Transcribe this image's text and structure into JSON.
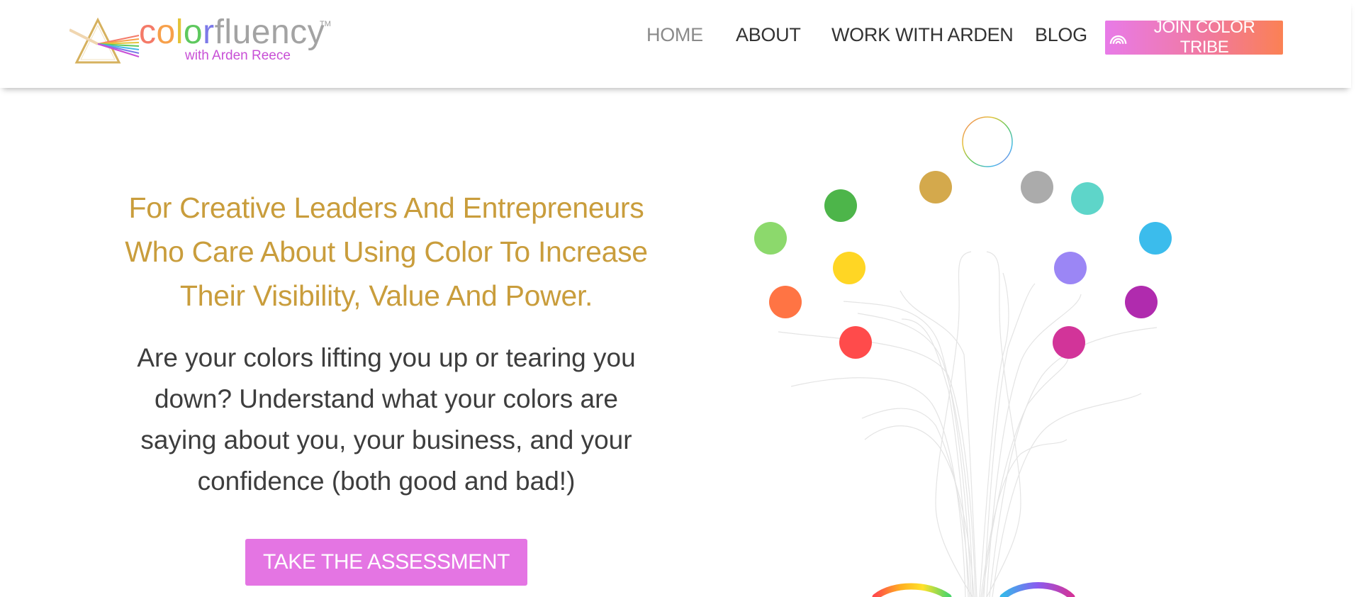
{
  "brand": {
    "word_parts": [
      {
        "text": "c",
        "color": "#f47a68"
      },
      {
        "text": "o",
        "color": "#f7a04a"
      },
      {
        "text": "l",
        "color": "#e3c43a"
      },
      {
        "text": "o",
        "color": "#5ec85e"
      },
      {
        "text": "r",
        "color": "#7c79e8"
      },
      {
        "text": "fluency",
        "color": "#a3a3a3"
      }
    ],
    "trademark": "TM",
    "subtitle": "with Arden Reece"
  },
  "nav": {
    "items": [
      {
        "label": "HOME",
        "active": true
      },
      {
        "label": "ABOUT",
        "active": false
      },
      {
        "label": "WORK WITH ARDEN",
        "active": false
      },
      {
        "label": "BLOG",
        "active": false
      }
    ],
    "cta_label": "JOIN COLOR TRIBE",
    "cta_icon": "rainbow-icon"
  },
  "hero": {
    "heading_lines": [
      "For Creative Leaders And Entrepreneurs",
      "Who Care About Using Color To Increase",
      "Their Visibility, Value And Power."
    ],
    "body_lines": [
      "Are your colors lifting you up or tearing you",
      "down? Understand what your colors are",
      "saying about you, your business, and your",
      "confidence (both good and bad!)"
    ],
    "button_label": "TAKE THE ASSESSMENT"
  },
  "illustration": {
    "name": "color-tree",
    "dot_colors": [
      "#ffffff",
      "#d4a94c",
      "#ababab",
      "#4db54a",
      "#5ed5c9",
      "#8cd96c",
      "#3bbcec",
      "#ffd624",
      "#9b86f5",
      "#ff7444",
      "#b02bae",
      "#ff4b4b",
      "#d23499"
    ]
  },
  "colors": {
    "heading": "#c99d3c",
    "body_text": "#3d3d3d",
    "nav_text": "#333333",
    "nav_active": "#8a8a8a",
    "assessment_button": "#e475e3"
  }
}
